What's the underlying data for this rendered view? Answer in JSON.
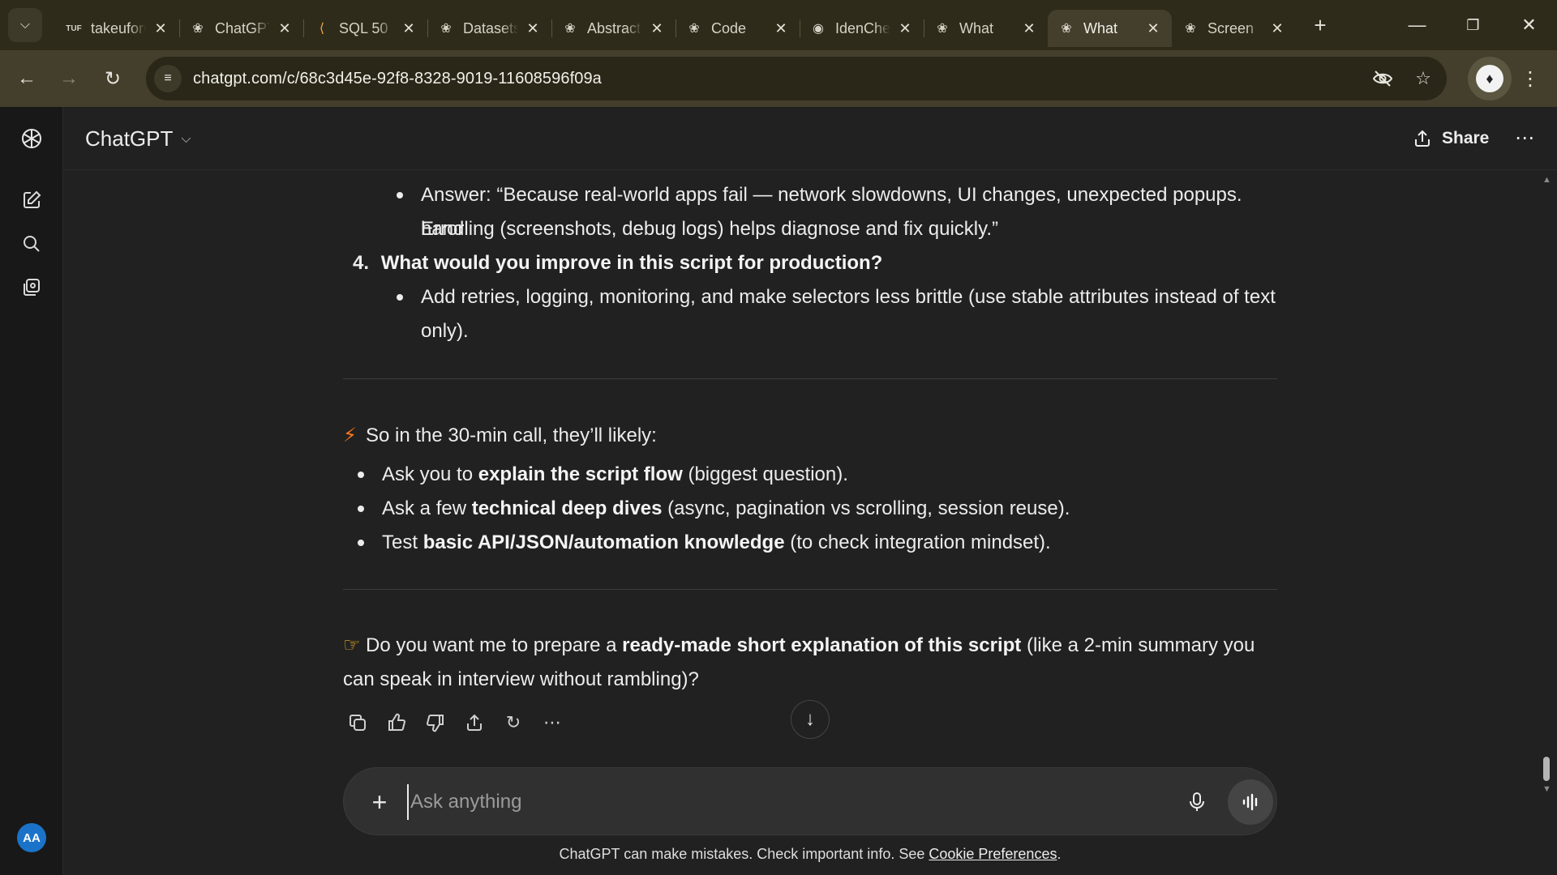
{
  "browser": {
    "tabs": [
      {
        "title": "takeuforward",
        "favicon": "tuf-logo",
        "active": false
      },
      {
        "title": "ChatGPT",
        "favicon": "openai-logo",
        "active": false
      },
      {
        "title": "SQL 50",
        "favicon": "leetcode-logo",
        "active": false
      },
      {
        "title": "Datasets",
        "favicon": "openai-logo",
        "active": false
      },
      {
        "title": "Abstract",
        "favicon": "openai-logo",
        "active": false
      },
      {
        "title": "Code",
        "favicon": "openai-logo",
        "active": false
      },
      {
        "title": "IdenCheck",
        "favicon": "github-logo",
        "active": false
      },
      {
        "title": "What",
        "favicon": "openai-logo",
        "active": false
      },
      {
        "title": "What",
        "favicon": "openai-logo",
        "active": true
      },
      {
        "title": "Screen",
        "favicon": "openai-logo",
        "active": false
      }
    ],
    "url": "chatgpt.com/c/68c3d45e-92f8-8328-9019-11608596f09a"
  },
  "header": {
    "model": "ChatGPT",
    "share_label": "Share"
  },
  "message": {
    "answer3_prefix": "Answer: “Because real-world apps fail — network slowdowns, UI changes, unexpected popups. Error",
    "answer3_cont": "handling (screenshots, debug logs) helps diagnose and fix quickly.”",
    "q4_num": "4.",
    "q4_text": "What would you improve in this script for production?",
    "q4_answer_line1": "Add retries, logging, monitoring, and make selectors less brittle (use stable attributes instead of text",
    "q4_answer_line2": "only).",
    "summary_intro": "So in the 30-min call, they’ll likely:",
    "summary_items": [
      {
        "pre": "Ask you to ",
        "bold": "explain the script flow",
        "post": " (biggest question)."
      },
      {
        "pre": "Ask a few ",
        "bold": "technical deep dives",
        "post": " (async, pagination vs scrolling, session reuse)."
      },
      {
        "pre": "Test ",
        "bold": "basic API/JSON/automation knowledge",
        "post": " (to check integration mindset)."
      }
    ],
    "followup_pre": "Do you want me to prepare a ",
    "followup_bold": "ready-made short explanation of this script",
    "followup_post": " (like a 2-min summary you",
    "followup_line2": "can speak in interview without rambling)?"
  },
  "composer": {
    "placeholder": "Ask anything",
    "value": ""
  },
  "footer": {
    "disclaimer": "ChatGPT can make mistakes. Check important info. See ",
    "link": "Cookie Preferences",
    "end": "."
  }
}
